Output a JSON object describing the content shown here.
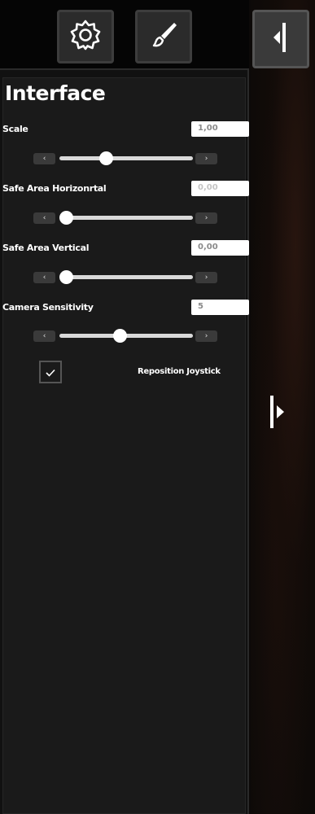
{
  "toolbar": {
    "settings_icon": "gear-icon",
    "brush_icon": "paintbrush-icon",
    "collapse_icon": "collapse-left-icon",
    "expand_icon": "expand-right-icon"
  },
  "section": {
    "title": "Interface"
  },
  "settings": [
    {
      "label": "Scale",
      "value": "1,00",
      "level": 0.35
    },
    {
      "label": "Safe Area Horizonrtal",
      "value": "0,00",
      "level": 0.05
    },
    {
      "label": "Safe Area Vertical",
      "value": "0,00",
      "level": 0.05
    },
    {
      "label": "Camera Sensitivity",
      "value": "5",
      "level": 0.45
    }
  ],
  "stepper": {
    "decrease": "‹",
    "increase": "›"
  },
  "checkbox": {
    "label": "Reposition Joystick",
    "checked": true
  },
  "colors": {
    "panel_bg": "#1a1a1a",
    "topbar_bg": "#050505",
    "button_bg": "#2b2b2b",
    "track": "#d9d9d9"
  }
}
